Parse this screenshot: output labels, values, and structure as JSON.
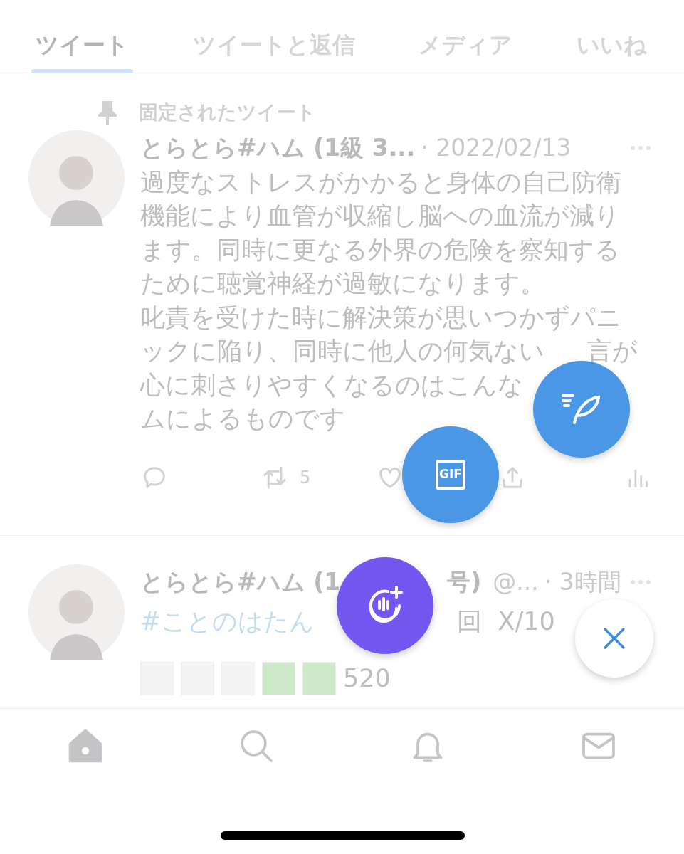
{
  "tabs": [
    {
      "label": "ツイート",
      "selected": true
    },
    {
      "label": "ツイートと返信",
      "selected": false
    },
    {
      "label": "メディア",
      "selected": false
    },
    {
      "label": "いいね",
      "selected": false
    }
  ],
  "pinned_label": "固定されたツイート",
  "tweets": [
    {
      "name": [
        "とらとら#ハム (1級 3..."
      ],
      "time": "· 2022/02/13",
      "body": [
        [
          "過度なストレスがかかると身体の自己防衛"
        ],
        [
          "機能により血管が収縮し脳への血流が減り"
        ],
        [
          "ます。同時に更なる外界の危険を察知する"
        ],
        [
          "ために聴覚神経が過敏になります。"
        ],
        [
          "叱責を受けた時に解決策が思いつかずパニ"
        ],
        [
          "ックに陥り、同時に他人の何気ない",
          "言が"
        ],
        [
          "心に刺さりやすくなるのはこんな"
        ],
        [
          "ムによるものです"
        ]
      ],
      "retweets": "5"
    },
    {
      "name": [
        "とらとら#ハム (1",
        "号)"
      ],
      "handle": "@...",
      "time": "· 3時間",
      "hashtag": "#ことのはたん",
      "after_hashtag": "回  X/10",
      "squares": [
        {
          "color": "#f4f4f4"
        },
        {
          "color": "#f4f4f4"
        },
        {
          "color": "#f4f4f4"
        },
        {
          "color": "#cdeac8"
        },
        {
          "color": "#cdeac8"
        }
      ],
      "square_caption": "520"
    }
  ],
  "fabs": [
    {
      "kind": "compose"
    },
    {
      "kind": "gif",
      "label": "GIF"
    },
    {
      "kind": "voice"
    },
    {
      "kind": "close"
    }
  ],
  "nav": [
    {
      "kind": "home",
      "selected": true
    },
    {
      "kind": "search",
      "selected": false
    },
    {
      "kind": "bell",
      "selected": false
    },
    {
      "kind": "mail",
      "selected": false
    }
  ]
}
